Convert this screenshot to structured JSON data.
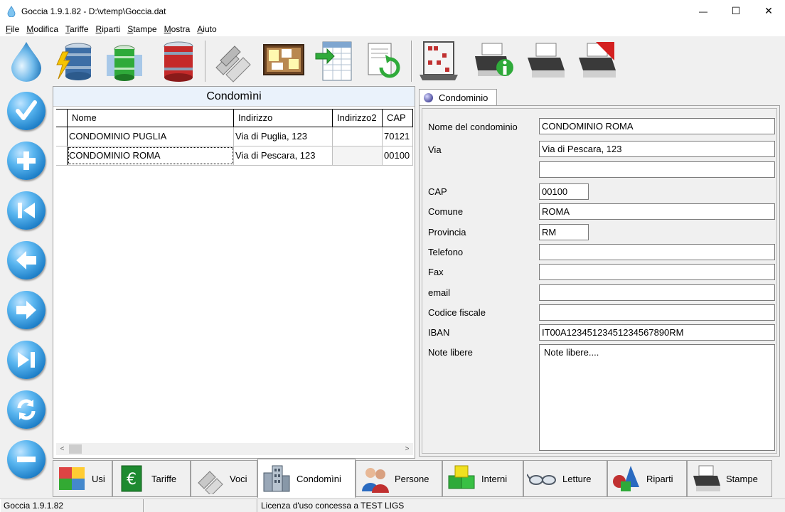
{
  "window": {
    "title": "Goccia 1.9.1.82 - D:\\vtemp\\Goccia.dat",
    "minimize_glyph": "—",
    "maximize_glyph": "☐",
    "close_glyph": "✕"
  },
  "menu": [
    {
      "u": "F",
      "rest": "ile"
    },
    {
      "u": "M",
      "rest": "odifica"
    },
    {
      "u": "T",
      "rest": "ariffe"
    },
    {
      "u": "R",
      "rest": "iparti"
    },
    {
      "u": "S",
      "rest": "tampe"
    },
    {
      "u": "M",
      "rest": "ostra"
    },
    {
      "u": "A",
      "rest": "iuto"
    }
  ],
  "toolbar": {
    "icons": [
      "water-drop-icon",
      "database-lightning-icon",
      "database-green-icon",
      "database-red-icon",
      "pipes-icon",
      "corkboard-icon",
      "spreadsheet-export-icon",
      "document-refresh-icon",
      "abacus-icon",
      "printer-info-icon",
      "printer-icon",
      "printer-pdf-icon"
    ]
  },
  "leftnav": {
    "buttons": [
      "confirm-button",
      "add-button",
      "first-record-button",
      "previous-record-button",
      "next-record-button",
      "last-record-button",
      "refresh-button",
      "delete-button"
    ]
  },
  "list": {
    "title": "Condomìni",
    "columns": [
      "Nome",
      "Indirizzo",
      "Indirizzo2",
      "CAP"
    ],
    "rows": [
      {
        "nome": "CONDOMINIO PUGLIA",
        "indirizzo": "Via di Puglia, 123",
        "indirizzo2": "",
        "cap": "70121"
      },
      {
        "nome": "CONDOMINIO ROMA",
        "indirizzo": "Via di Pescara, 123",
        "indirizzo2": "",
        "cap": "00100"
      }
    ],
    "scroll_left": "<",
    "scroll_right": ">"
  },
  "detail": {
    "tab_label": "Condominio",
    "fields": {
      "nome_label": "Nome del condominio",
      "nome_value": "CONDOMINIO ROMA",
      "via_label": "Via",
      "via_value": "Via di Pescara, 123",
      "via2_value": "",
      "cap_label": "CAP",
      "cap_value": "00100",
      "comune_label": "Comune",
      "comune_value": "ROMA",
      "provincia_label": "Provincia",
      "provincia_value": "RM",
      "telefono_label": "Telefono",
      "telefono_value": "",
      "fax_label": "Fax",
      "fax_value": "",
      "email_label": "email",
      "email_value": "",
      "cf_label": "Codice fiscale",
      "cf_value": "",
      "iban_label": "IBAN",
      "iban_value": "IT00A12345123451234567890RM",
      "note_label": "Note libere",
      "note_value": "Note libere...."
    }
  },
  "bottom_tabs": [
    {
      "label": "Usi",
      "icon": "usi-icon"
    },
    {
      "label": "Tariffe",
      "icon": "euro-icon"
    },
    {
      "label": "Voci",
      "icon": "pipes-icon"
    },
    {
      "label": "Condomìni",
      "icon": "buildings-icon"
    },
    {
      "label": "Persone",
      "icon": "people-icon"
    },
    {
      "label": "Interni",
      "icon": "cubes-icon"
    },
    {
      "label": "Letture",
      "icon": "glasses-icon"
    },
    {
      "label": "Riparti",
      "icon": "shapes-icon"
    },
    {
      "label": "Stampe",
      "icon": "printer-icon"
    }
  ],
  "status": {
    "version": "Goccia 1.9.1.82",
    "middle": "",
    "license": "Licenza d'uso concessa a TEST LIGS"
  },
  "colors": {
    "accent_blue": "#1e7fc8",
    "list_title_bg": "#eaf2fb"
  }
}
